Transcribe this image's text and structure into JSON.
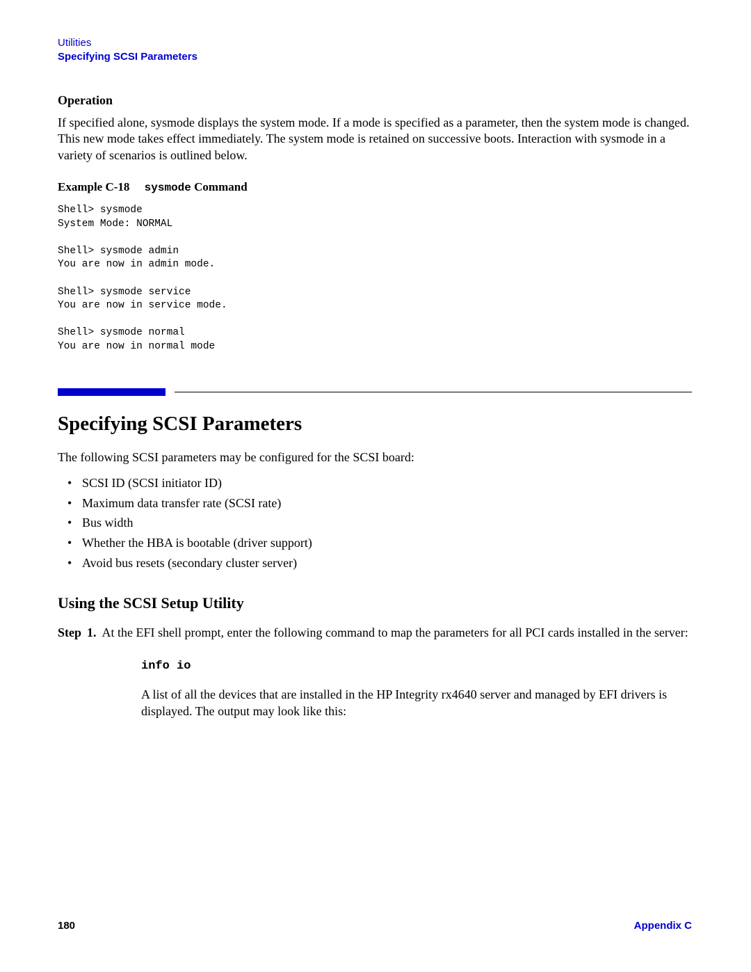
{
  "header": {
    "chapter": "Utilities",
    "section": "Specifying SCSI Parameters"
  },
  "operation": {
    "heading": "Operation",
    "text": "If specified alone, sysmode displays the system mode. If a mode is specified as a parameter, then the system mode is changed. This new mode takes effect immediately. The system mode is retained on successive boots. Interaction with sysmode in a variety of scenarios is outlined below."
  },
  "example": {
    "label_prefix": "Example C-18",
    "cmd": "sysmode",
    "label_suffix": " Command",
    "code": "Shell> sysmode\nSystem Mode: NORMAL\n\nShell> sysmode admin\nYou are now in admin mode.\n\nShell> sysmode service\nYou are now in service mode.\n\nShell> sysmode normal\nYou are now in normal mode"
  },
  "scsi": {
    "title": "Specifying SCSI Parameters",
    "intro": "The following SCSI parameters may be configured for the SCSI board:",
    "bullets": [
      "SCSI ID (SCSI initiator ID)",
      "Maximum data transfer rate (SCSI rate)",
      "Bus width",
      "Whether the HBA is bootable (driver support)",
      "Avoid bus resets (secondary cluster server)"
    ],
    "subheading": "Using the SCSI Setup Utility",
    "step_label": "Step",
    "step_num": "1.",
    "step_text": "At the EFI shell prompt, enter the following command to map the parameters for all PCI cards installed in the server:",
    "step_cmd": "info io",
    "step_result": "A list of all the devices that are installed in the HP Integrity rx4640 server and managed by EFI drivers is displayed. The output may look like this:"
  },
  "footer": {
    "page": "180",
    "appendix": "Appendix C"
  }
}
